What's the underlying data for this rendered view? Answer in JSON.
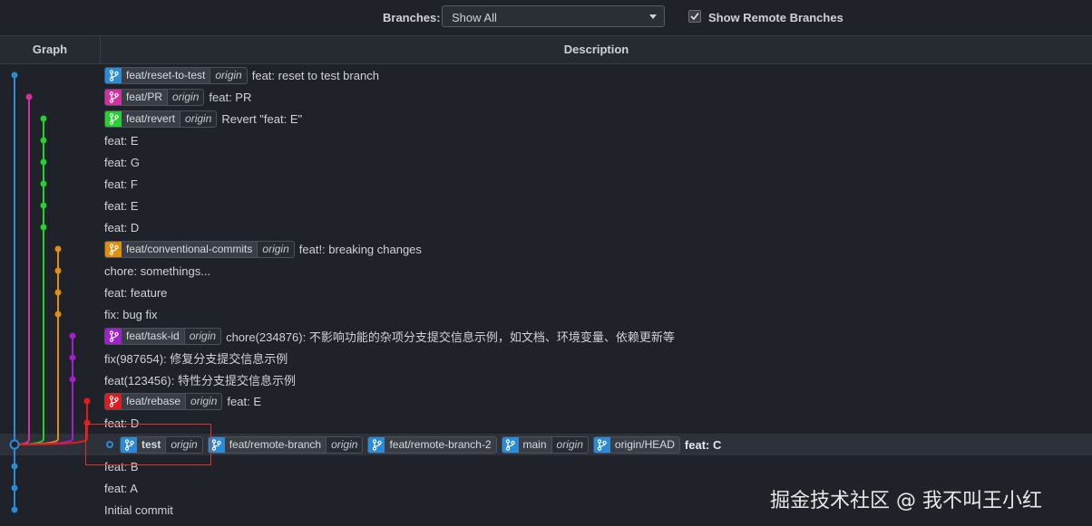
{
  "toolbar": {
    "branches_label": "Branches:",
    "branches_value": "Show All",
    "show_remote_label": "Show Remote Branches",
    "show_remote_checked": true
  },
  "columns": {
    "graph": "Graph",
    "description": "Description"
  },
  "colors": {
    "blue": "#2a8bd8",
    "magenta": "#d42ea0",
    "green": "#25d12f",
    "orange": "#e08e0b",
    "purple": "#a11ed1",
    "red": "#e11b1b"
  },
  "commits": [
    {
      "refs": [
        {
          "name": "feat/reset-to-test",
          "remote": "origin",
          "color": "#2a8bd8"
        }
      ],
      "message": "feat: reset to test branch"
    },
    {
      "refs": [
        {
          "name": "feat/PR",
          "remote": "origin",
          "color": "#d42ea0"
        }
      ],
      "message": "feat: PR"
    },
    {
      "refs": [
        {
          "name": "feat/revert",
          "remote": "origin",
          "color": "#25d12f"
        }
      ],
      "message": "Revert \"feat: E\""
    },
    {
      "refs": [],
      "message": "feat: E"
    },
    {
      "refs": [],
      "message": "feat: G"
    },
    {
      "refs": [],
      "message": "feat: F"
    },
    {
      "refs": [],
      "message": "feat: E"
    },
    {
      "refs": [],
      "message": "feat: D"
    },
    {
      "refs": [
        {
          "name": "feat/conventional-commits",
          "remote": "origin",
          "color": "#e08e0b"
        }
      ],
      "message": "feat!: breaking changes"
    },
    {
      "refs": [],
      "message": "chore: somethings..."
    },
    {
      "refs": [],
      "message": "feat: feature"
    },
    {
      "refs": [],
      "message": "fix: bug fix"
    },
    {
      "refs": [
        {
          "name": "feat/task-id",
          "remote": "origin",
          "color": "#a11ed1"
        }
      ],
      "message": "chore(234876): 不影响功能的杂项分支提交信息示例，如文档、环境变量、依赖更新等"
    },
    {
      "refs": [],
      "message": "fix(987654): 修复分支提交信息示例"
    },
    {
      "refs": [],
      "message": "feat(123456): 特性分支提交信息示例"
    },
    {
      "refs": [
        {
          "name": "feat/rebase",
          "remote": "origin",
          "color": "#e11b1b"
        }
      ],
      "message": "feat: E"
    },
    {
      "refs": [],
      "message": "feat: D"
    },
    {
      "head": true,
      "selected": true,
      "bold": true,
      "refs": [
        {
          "name": "test",
          "remote": "origin",
          "color": "#2a8bd8",
          "bold": true
        },
        {
          "name": "feat/remote-branch",
          "remote": "origin",
          "color": "#2a8bd8"
        },
        {
          "name": "feat/remote-branch-2",
          "remote": "",
          "color": "#2a8bd8"
        },
        {
          "name": "main",
          "remote": "origin",
          "color": "#2a8bd8"
        },
        {
          "name": "origin/HEAD",
          "remote": "",
          "color": "#2a8bd8"
        }
      ],
      "message": "feat: C"
    },
    {
      "refs": [],
      "message": "feat: B"
    },
    {
      "refs": [],
      "message": "feat: A"
    },
    {
      "refs": [],
      "message": "Initial commit"
    }
  ],
  "watermark": "掘金技术社区 @ 我不叫王小红"
}
